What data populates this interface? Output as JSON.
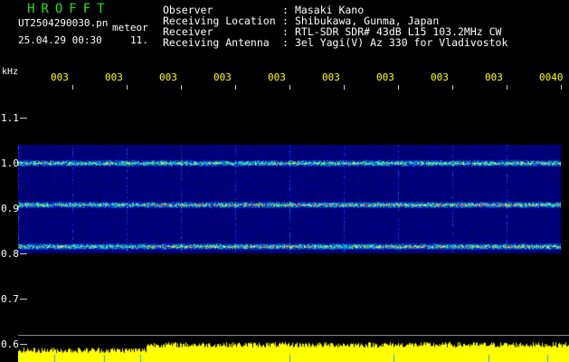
{
  "header": {
    "title": "HROFFT",
    "filename": "UT2504290030.pn",
    "meteor_label": "meteor",
    "datetime": "25.04.29 00:30",
    "count": "11."
  },
  "info": [
    {
      "label": "Observer",
      "value": "Masaki Kano"
    },
    {
      "label": "Receiving Location",
      "value": "Shibukawa, Gunma, Japan"
    },
    {
      "label": "Receiver",
      "value": "RTL-SDR SDR# 43dB L15 103.2MHz CW"
    },
    {
      "label": "Receiving Antenna",
      "value": "3el Yagi(V) Az 330 for Vladivostok"
    }
  ],
  "axis": {
    "unit": "kHz",
    "time_labels": [
      "003",
      "003",
      "003",
      "003",
      "003",
      "003",
      "003",
      "003",
      "003",
      "0040"
    ],
    "freq_labels": [
      "1.1",
      "1.0",
      "0.9",
      "0.8",
      "0.7",
      "0.6"
    ]
  },
  "colors": {
    "header_title": "#22e022",
    "time_labels": "#ffff00",
    "power_trace": "#ffff00",
    "background": "#000000"
  }
}
